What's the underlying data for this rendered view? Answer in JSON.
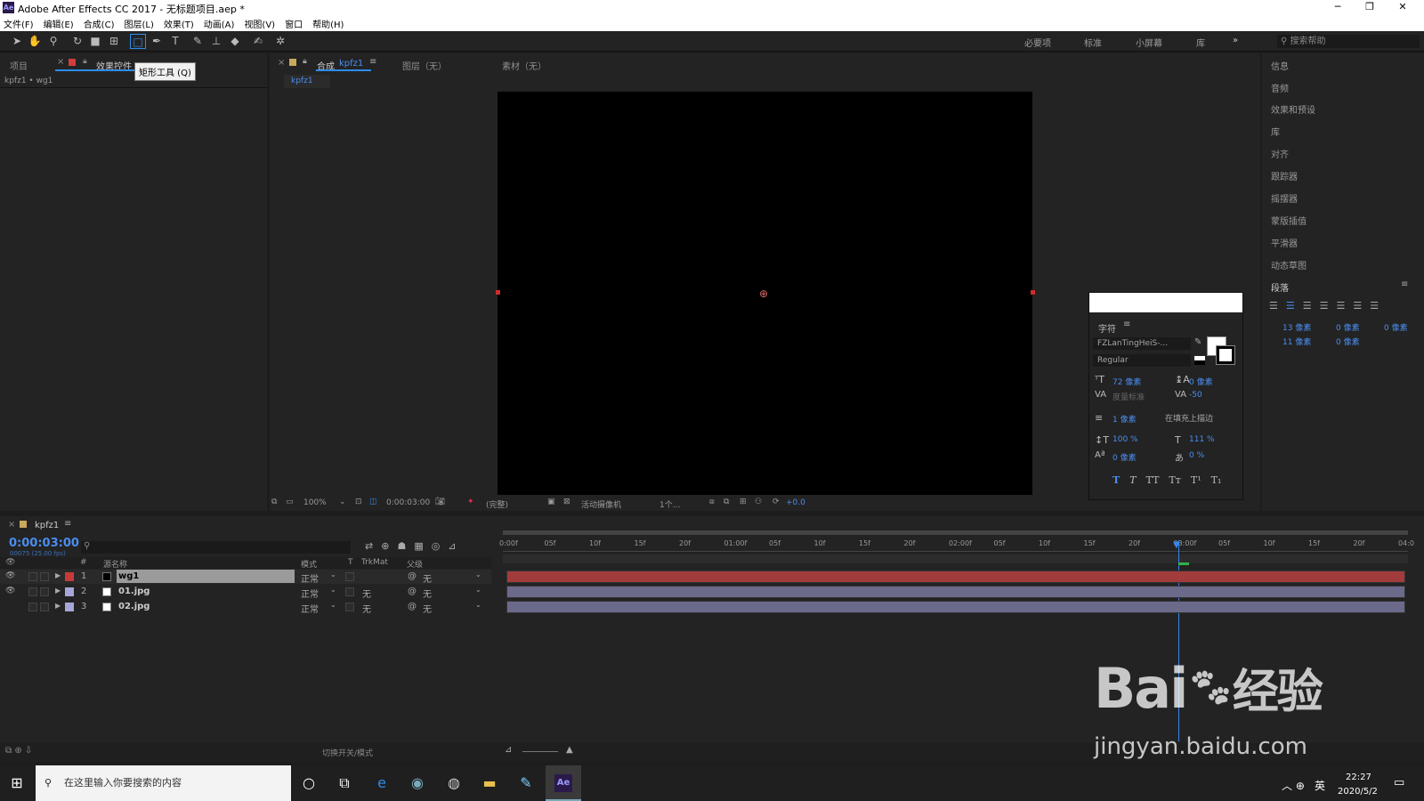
{
  "window": {
    "title": "Adobe After Effects CC 2017 - 无标题项目.aep *",
    "app_icon": "Ae",
    "min": "─",
    "max": "❐",
    "close": "✕"
  },
  "menu": [
    "文件(F)",
    "编辑(E)",
    "合成(C)",
    "图层(L)",
    "效果(T)",
    "动画(A)",
    "视图(V)",
    "窗口",
    "帮助(H)"
  ],
  "workspaces": [
    "必要项",
    "标准",
    "小屏幕",
    "库"
  ],
  "search_help": "搜索帮助",
  "tooltip": "矩形工具 (Q)",
  "left_panel": {
    "tab1": "项目",
    "tab2": "效果控件",
    "breadcrumb": "kpfz1 • wg1"
  },
  "comp_panel": {
    "tab_comp": "合成",
    "comp_name": "kpfz1",
    "tab_layer": "图层（无）",
    "tab_footage": "素材（无）",
    "subtab": "kpfz1"
  },
  "viewer_bar": {
    "zoom": "100%",
    "time": "0:00:03:00",
    "quality": "(完整)",
    "camera": "活动摄像机",
    "views": "1个...",
    "exposure": "+0.0"
  },
  "right_panel": {
    "items": [
      "信息",
      "音频",
      "效果和预设",
      "库",
      "对齐",
      "跟踪器",
      "摇摆器",
      "蒙版插值",
      "平滑器",
      "动态草图"
    ],
    "paragraph": "段落",
    "indent": [
      "13 像素",
      "0 像素",
      "0 像素",
      "11 像素",
      "0 像素"
    ]
  },
  "character": {
    "title": "字符",
    "font": "FZLanTingHeiS-...",
    "style": "Regular",
    "size": "72 像素",
    "leading": "0 像素",
    "kerning": "度量标准",
    "tracking": "-50",
    "stroke": "1 像素",
    "stroke_mode": "在填充上描边",
    "vscale": "100 %",
    "hscale": "111 %",
    "baseline": "0 像素",
    "tsume": "0 %",
    "fmt": [
      "T",
      "T",
      "TT",
      "Tт",
      "T¹",
      "T₁"
    ]
  },
  "timeline": {
    "comp": "kpfz1",
    "time": "0:00:03:00",
    "frames": "00075 (25.00 fps)",
    "headers": {
      "name": "源名称",
      "mode": "模式",
      "t": "T",
      "trkmat": "TrkMat",
      "parent": "父级"
    },
    "layers": [
      {
        "num": "1",
        "name": "wg1",
        "mode": "正常",
        "trk": "",
        "parent": "无",
        "color": "#c83a3a"
      },
      {
        "num": "2",
        "name": "01.jpg",
        "mode": "正常",
        "trk": "无",
        "parent": "无",
        "color": "#a7a6d8"
      },
      {
        "num": "3",
        "name": "02.jpg",
        "mode": "正常",
        "trk": "无",
        "parent": "无",
        "color": "#a7a6d8"
      }
    ],
    "ruler": [
      "0:00f",
      "05f",
      "10f",
      "15f",
      "20f",
      "01:00f",
      "05f",
      "10f",
      "15f",
      "20f",
      "02:00f",
      "05f",
      "10f",
      "15f",
      "20f",
      "03:00f",
      "05f",
      "10f",
      "15f",
      "20f",
      "04:0"
    ],
    "footer": "切换开关/模式"
  },
  "taskbar": {
    "search": "在这里输入你要搜索的内容",
    "time": "22:27",
    "date": "2020/5/2",
    "ime": "英"
  },
  "watermark": {
    "brand": "Bai",
    "brand2": "经验",
    "url": "jingyan.baidu.com"
  }
}
